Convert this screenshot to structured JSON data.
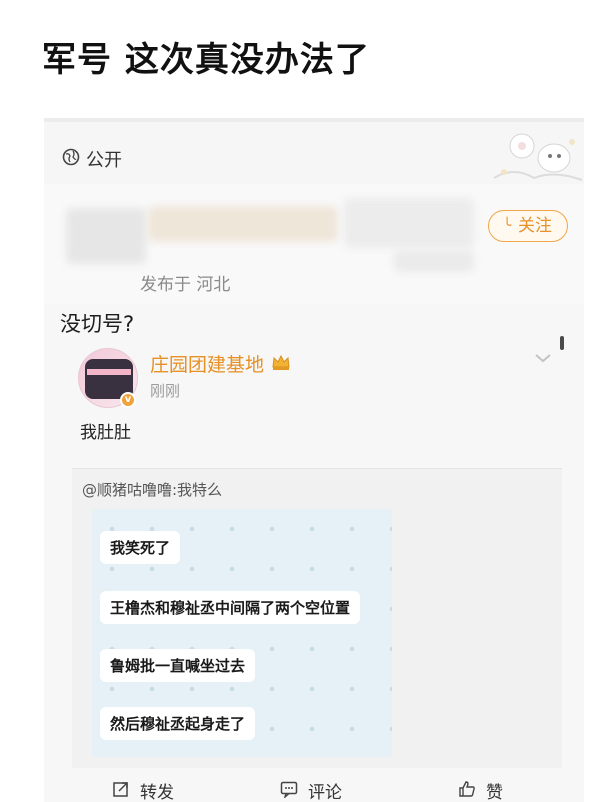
{
  "headline": "军号 这次真没办法了",
  "post": {
    "visibility_label": "公开",
    "follow_label": "关注",
    "location_meta": "发布于 河北",
    "text": "没切号?"
  },
  "repost": {
    "author_name": "庄园团建基地",
    "time": "刚刚",
    "text": "我肚肚",
    "quoted_header": "@顺猪咕噜噜:我特么",
    "chat_messages": [
      "我笑死了",
      "王橹杰和穆祉丞中间隔了两个空位置",
      "鲁姆批一直喊坐过去",
      "然后穆祉丞起身走了"
    ]
  },
  "actions": {
    "share_label": "转发",
    "comment_label": "评论",
    "like_label": "赞"
  },
  "icons": {
    "visibility": "globe-icon",
    "share": "share-icon",
    "comment": "comment-icon",
    "like": "thumbs-up-icon",
    "dropdown": "chevron-down-icon",
    "vip": "crown-icon",
    "verified": "verified-badge-icon"
  },
  "colors": {
    "accent": "#e69026",
    "background": "#f7f7f7",
    "chat_bg": "#e5f1f6"
  }
}
